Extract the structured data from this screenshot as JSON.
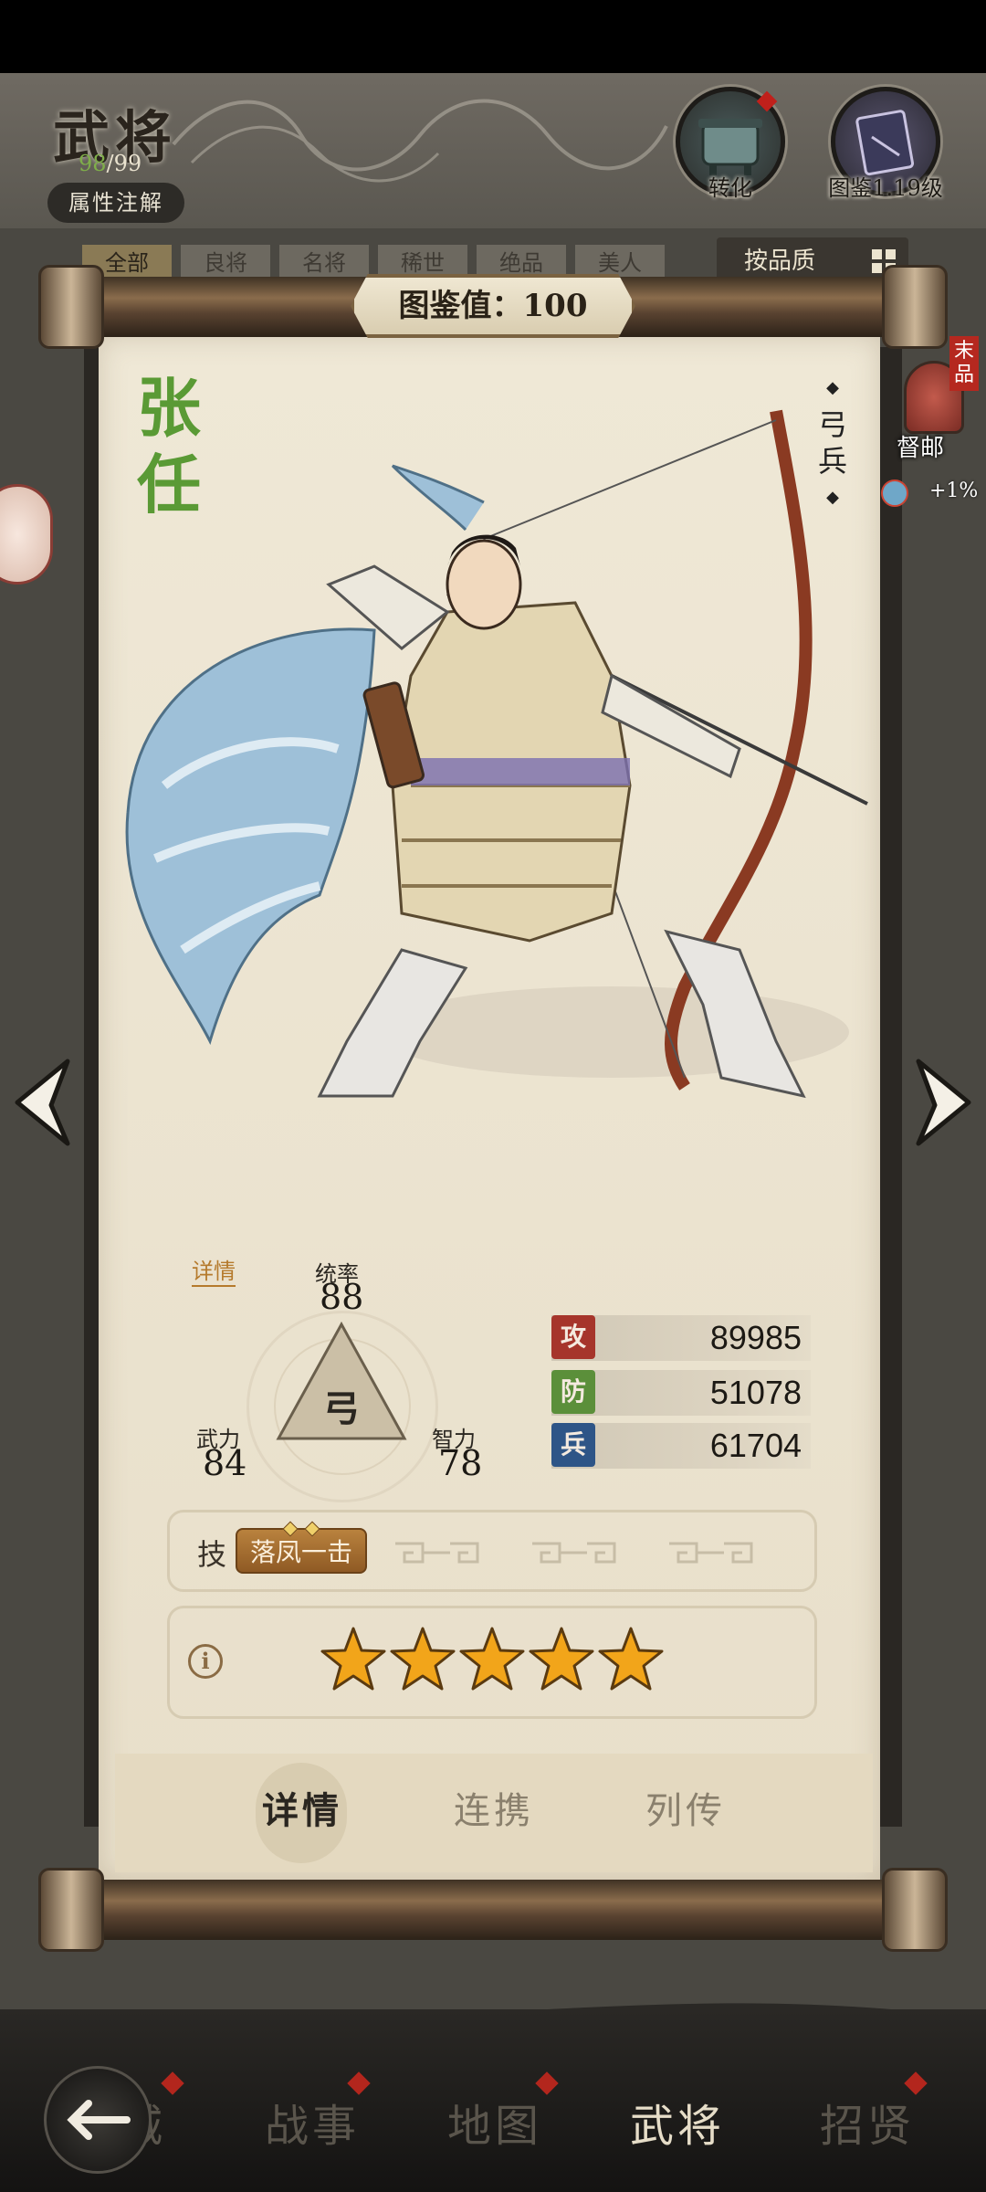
{
  "header": {
    "title": "武将",
    "progress_current": "98",
    "progress_total": "/99",
    "attr_notes_label": "属性注解",
    "transform_label": "转化",
    "codex_label": "图鉴1.19级"
  },
  "filters": {
    "tabs": [
      "全部",
      "良将",
      "名将",
      "稀世",
      "绝品",
      "美人"
    ],
    "sort_label": "按品质"
  },
  "codex_value": "图鉴值：100",
  "hero": {
    "name_chars": [
      "张",
      "任"
    ],
    "unit_type_chars": [
      "弓",
      "兵"
    ],
    "rank_tag": "末品",
    "rank_label": "督邮",
    "bonus": "+1%",
    "details_link": "详情",
    "triangle_glyph": "弓",
    "stats": {
      "lead_label": "统率",
      "lead_value": "88",
      "force_label": "武力",
      "force_value": "84",
      "intel_label": "智力",
      "intel_value": "78"
    },
    "bars": [
      {
        "icon": "攻",
        "value": "89985",
        "color": "#a6352b"
      },
      {
        "icon": "防",
        "value": "51078",
        "color": "#5b8f3a"
      },
      {
        "icon": "兵",
        "value": "61704",
        "color": "#2e5587"
      }
    ],
    "skill_label": "技",
    "skill_name": "落凤一击",
    "stars": 5
  },
  "paper_tabs": [
    "详情",
    "连携",
    "列传"
  ],
  "bottom_nav": {
    "items": [
      "城",
      "战事",
      "地图",
      "武将",
      "招贤"
    ],
    "active_index": 3
  },
  "colors": {
    "paper": "#efe8d6",
    "name_green": "#5a9a35",
    "star_gold": "#f2a51a"
  }
}
